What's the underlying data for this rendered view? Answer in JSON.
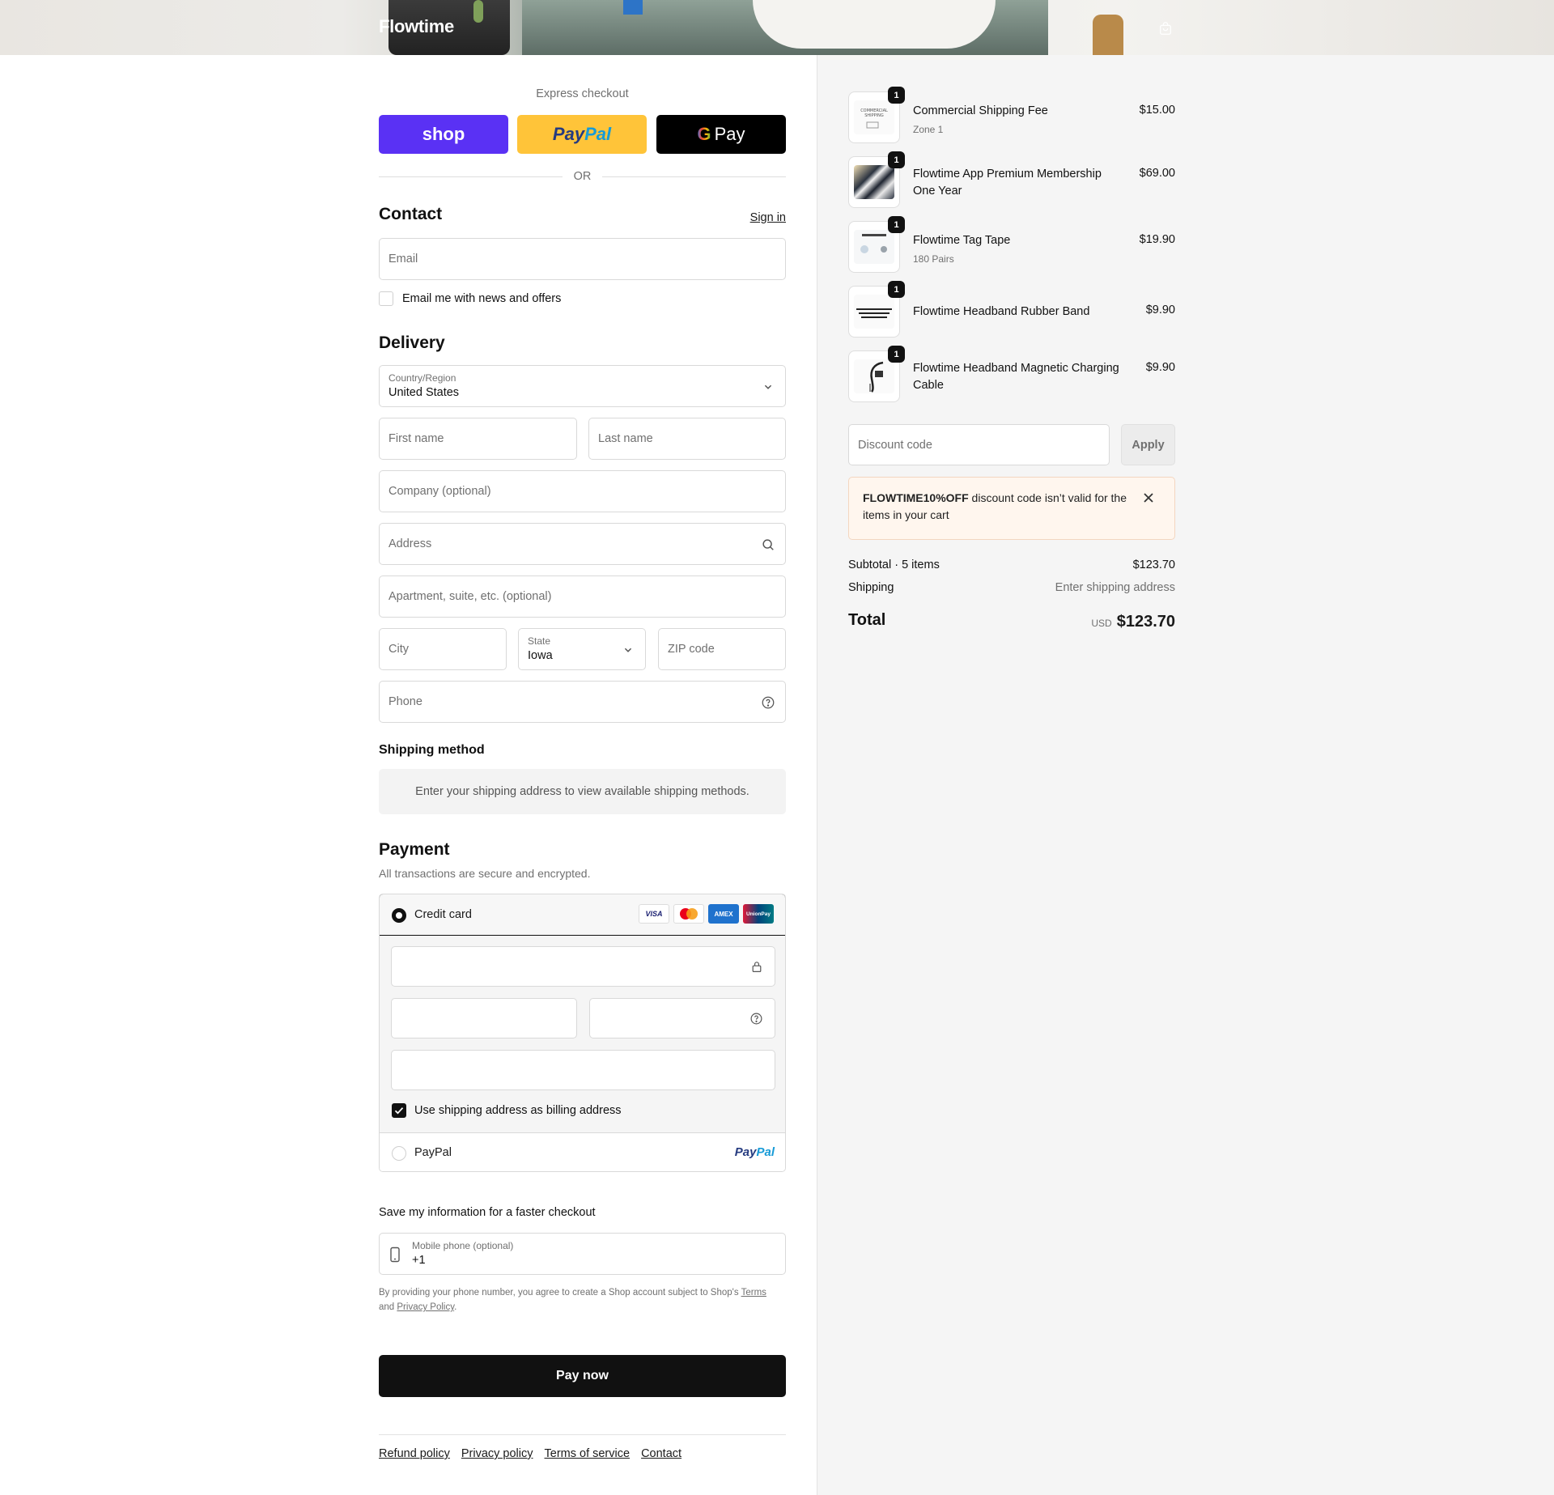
{
  "header": {
    "logo": "Flowtime",
    "cart_icon": "shopping-bag-icon"
  },
  "express": {
    "label": "Express checkout",
    "shop_label": "shop",
    "paypal_part1": "Pay",
    "paypal_part2": "Pal",
    "gpay_g": "G",
    "gpay_label": "Pay",
    "or_label": "OR"
  },
  "contact": {
    "title": "Contact",
    "signin_label": "Sign in",
    "email_placeholder": "Email",
    "news_label": "Email me with news and offers"
  },
  "delivery": {
    "title": "Delivery",
    "country_label": "Country/Region",
    "country_value": "United States",
    "first_name_placeholder": "First name",
    "last_name_placeholder": "Last name",
    "company_placeholder": "Company (optional)",
    "address_placeholder": "Address",
    "apartment_placeholder": "Apartment, suite, etc. (optional)",
    "city_placeholder": "City",
    "state_label": "State",
    "state_value": "Iowa",
    "zip_placeholder": "ZIP code",
    "phone_placeholder": "Phone"
  },
  "shipping_method": {
    "title": "Shipping method",
    "message": "Enter your shipping address to view available shipping methods."
  },
  "payment": {
    "title": "Payment",
    "subtitle": "All transactions are secure and encrypted.",
    "credit_card_label": "Credit card",
    "card_brands": [
      "VISA",
      "",
      "AMEX",
      "UnionPay"
    ],
    "billing_label": "Use shipping address as billing address",
    "paypal_label": "PayPal",
    "paypal_logo_part1": "Pay",
    "paypal_logo_part2": "Pal"
  },
  "save_info": {
    "title": "Save my information for a faster checkout",
    "mobile_label": "Mobile phone (optional)",
    "mobile_value": "+1",
    "fine_text": "By providing your phone number, you agree to create a Shop account subject to Shop's",
    "terms_label": "Terms",
    "and_label": "and",
    "privacy_label": "Privacy Policy",
    "period": "."
  },
  "pay_now_label": "Pay now",
  "footer": {
    "links": [
      "Refund policy",
      "Privacy policy",
      "Terms of service",
      "Contact"
    ]
  },
  "summary": {
    "items": [
      {
        "name": "Commercial Shipping Fee",
        "sub": "Zone 1",
        "price": "$15.00",
        "qty": "1"
      },
      {
        "name": "Flowtime App Premium Membership One Year",
        "sub": "",
        "price": "$69.00",
        "qty": "1"
      },
      {
        "name": "Flowtime Tag Tape",
        "sub": "180 Pairs",
        "price": "$19.90",
        "qty": "1"
      },
      {
        "name": "Flowtime Headband Rubber Band",
        "sub": "",
        "price": "$9.90",
        "qty": "1"
      },
      {
        "name": "Flowtime Headband Magnetic Charging Cable",
        "sub": "",
        "price": "$9.90",
        "qty": "1"
      }
    ],
    "discount_placeholder": "Discount code",
    "apply_label": "Apply",
    "alert_code": "FLOWTIME10%OFF",
    "alert_text": " discount code isn’t valid for the items in your cart",
    "subtotal_label": "Subtotal · 5 items",
    "subtotal_value": "$123.70",
    "shipping_label": "Shipping",
    "shipping_value": "Enter shipping address",
    "total_label": "Total",
    "currency": "USD",
    "total_value": "$123.70"
  },
  "colors": {
    "shop": "#5a31f4",
    "paypal": "#ffc439",
    "dark": "#111111",
    "alert_bg": "#fff6ee"
  }
}
